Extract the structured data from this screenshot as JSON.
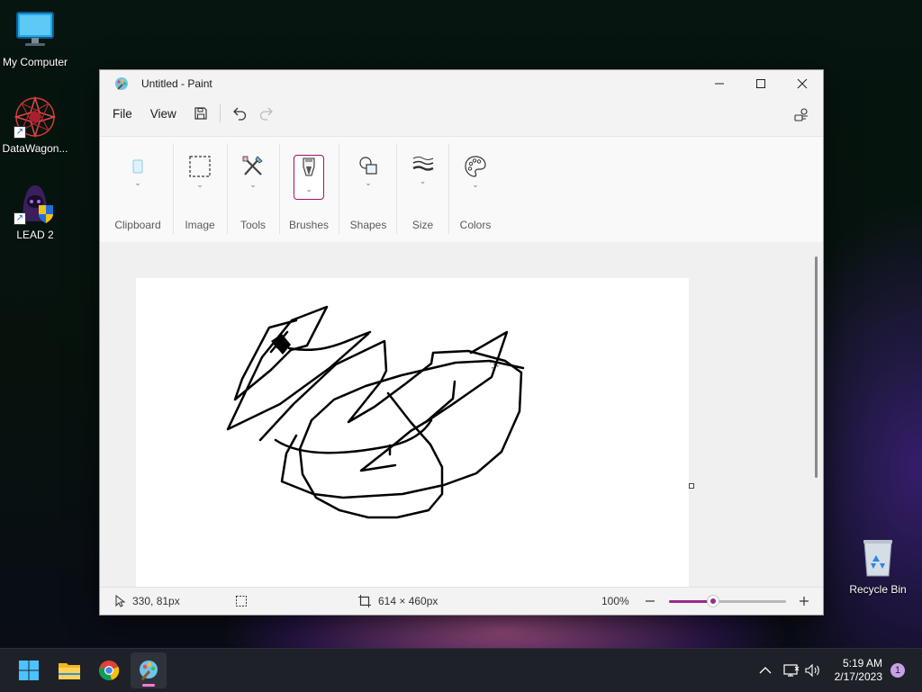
{
  "desktop": {
    "icons": [
      {
        "label": "My Computer",
        "icon": "monitor-icon"
      },
      {
        "label": "DataWagon...",
        "icon": "datawagon-icon"
      },
      {
        "label": "LEAD 2",
        "icon": "lead-icon"
      },
      {
        "label": "Recycle Bin",
        "icon": "recycle-bin-icon"
      }
    ]
  },
  "window": {
    "title": "Untitled - Paint",
    "menu": {
      "file": "File",
      "view": "View"
    },
    "ribbon_groups": [
      {
        "label": "Clipboard",
        "icon": "clipboard-icon"
      },
      {
        "label": "Image",
        "icon": "selection-icon"
      },
      {
        "label": "Tools",
        "icon": "tools-icon"
      },
      {
        "label": "Brushes",
        "icon": "brush-icon"
      },
      {
        "label": "Shapes",
        "icon": "shapes-icon"
      },
      {
        "label": "Size",
        "icon": "size-icon"
      },
      {
        "label": "Colors",
        "icon": "palette-icon"
      }
    ],
    "status": {
      "cursor_position": "330, 81px",
      "canvas_size": "614 × 460px",
      "zoom": "100%",
      "zoom_level_fraction": 0.38
    }
  },
  "taskbar": {
    "apps": [
      "start-icon",
      "file-explorer-icon",
      "chrome-icon",
      "paint-icon"
    ],
    "time": "5:19 AM",
    "date": "2/17/2023",
    "notification_count": "1"
  },
  "colors": {
    "accent": "#9a2a8f",
    "brush_active": "#a01070"
  }
}
